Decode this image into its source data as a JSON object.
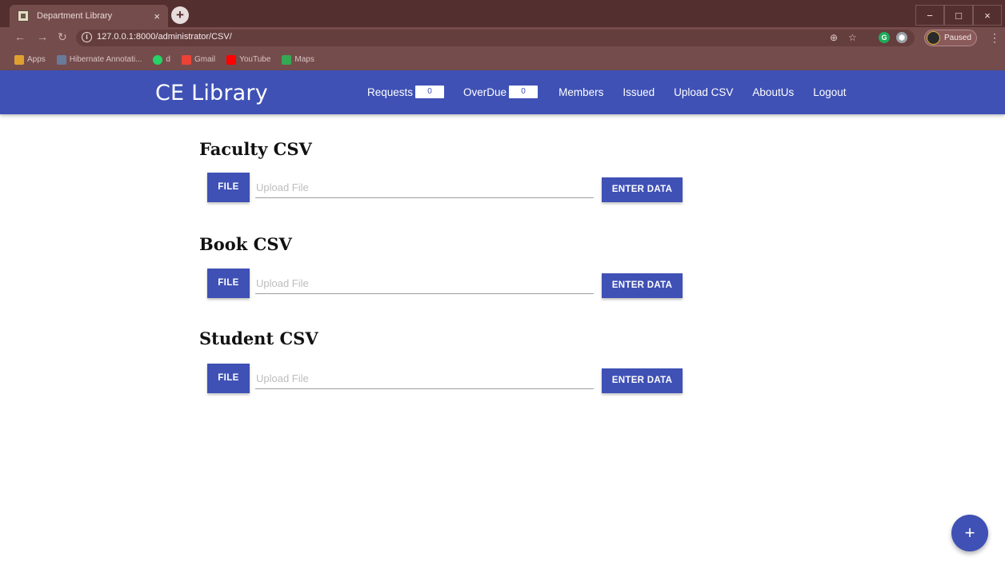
{
  "browser": {
    "tab_title": "Department Library",
    "tab_close": "×",
    "new_tab": "+",
    "url": "127.0.0.1:8000/administrator/CSV/",
    "profile_label": "Paused",
    "bookmarks": [
      {
        "label": "Apps",
        "icon_color": "#e0a030"
      },
      {
        "label": "Hibernate Annotati...",
        "icon_color": "#6a7a9a"
      },
      {
        "label": "d",
        "icon_color": "#25d366"
      },
      {
        "label": "Gmail",
        "icon_color": "#ea4335"
      },
      {
        "label": "YouTube",
        "icon_color": "#ff0000"
      },
      {
        "label": "Maps",
        "icon_color": "#34a853"
      }
    ],
    "window_controls": {
      "minimize": "−",
      "maximize": "□",
      "close": "×"
    }
  },
  "navbar": {
    "brand": "CE Library",
    "links": [
      {
        "label": "Requests",
        "badge": "0"
      },
      {
        "label": "OverDue",
        "badge": "0"
      },
      {
        "label": "Members"
      },
      {
        "label": "Issued"
      },
      {
        "label": "Upload CSV"
      },
      {
        "label": "AboutUs"
      },
      {
        "label": "Logout"
      }
    ]
  },
  "sections": [
    {
      "title": "Faculty CSV",
      "file_label": "FILE",
      "placeholder": "Upload File",
      "submit_label": "ENTER DATA"
    },
    {
      "title": "Book CSV",
      "file_label": "FILE",
      "placeholder": "Upload File",
      "submit_label": "ENTER DATA"
    },
    {
      "title": "Student CSV",
      "file_label": "FILE",
      "placeholder": "Upload File",
      "submit_label": "ENTER DATA"
    }
  ],
  "fab": {
    "label": "+"
  },
  "colors": {
    "primary": "#3f51b5",
    "chrome_dark": "#542f2f",
    "chrome": "#754c4c"
  }
}
